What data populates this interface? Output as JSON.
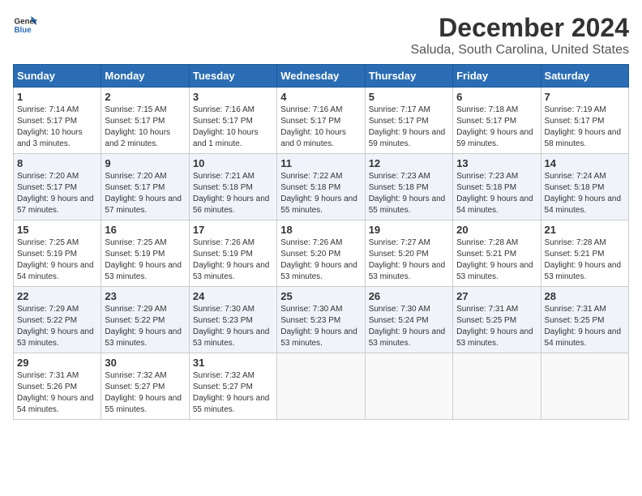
{
  "logo": {
    "line1": "General",
    "line2": "Blue"
  },
  "title": "December 2024",
  "location": "Saluda, South Carolina, United States",
  "days_of_week": [
    "Sunday",
    "Monday",
    "Tuesday",
    "Wednesday",
    "Thursday",
    "Friday",
    "Saturday"
  ],
  "weeks": [
    [
      {
        "day": "1",
        "sunrise": "7:14 AM",
        "sunset": "5:17 PM",
        "daylight": "10 hours and 3 minutes."
      },
      {
        "day": "2",
        "sunrise": "7:15 AM",
        "sunset": "5:17 PM",
        "daylight": "10 hours and 2 minutes."
      },
      {
        "day": "3",
        "sunrise": "7:16 AM",
        "sunset": "5:17 PM",
        "daylight": "10 hours and 1 minute."
      },
      {
        "day": "4",
        "sunrise": "7:16 AM",
        "sunset": "5:17 PM",
        "daylight": "10 hours and 0 minutes."
      },
      {
        "day": "5",
        "sunrise": "7:17 AM",
        "sunset": "5:17 PM",
        "daylight": "9 hours and 59 minutes."
      },
      {
        "day": "6",
        "sunrise": "7:18 AM",
        "sunset": "5:17 PM",
        "daylight": "9 hours and 59 minutes."
      },
      {
        "day": "7",
        "sunrise": "7:19 AM",
        "sunset": "5:17 PM",
        "daylight": "9 hours and 58 minutes."
      }
    ],
    [
      {
        "day": "8",
        "sunrise": "7:20 AM",
        "sunset": "5:17 PM",
        "daylight": "9 hours and 57 minutes."
      },
      {
        "day": "9",
        "sunrise": "7:20 AM",
        "sunset": "5:17 PM",
        "daylight": "9 hours and 57 minutes."
      },
      {
        "day": "10",
        "sunrise": "7:21 AM",
        "sunset": "5:18 PM",
        "daylight": "9 hours and 56 minutes."
      },
      {
        "day": "11",
        "sunrise": "7:22 AM",
        "sunset": "5:18 PM",
        "daylight": "9 hours and 55 minutes."
      },
      {
        "day": "12",
        "sunrise": "7:23 AM",
        "sunset": "5:18 PM",
        "daylight": "9 hours and 55 minutes."
      },
      {
        "day": "13",
        "sunrise": "7:23 AM",
        "sunset": "5:18 PM",
        "daylight": "9 hours and 54 minutes."
      },
      {
        "day": "14",
        "sunrise": "7:24 AM",
        "sunset": "5:18 PM",
        "daylight": "9 hours and 54 minutes."
      }
    ],
    [
      {
        "day": "15",
        "sunrise": "7:25 AM",
        "sunset": "5:19 PM",
        "daylight": "9 hours and 54 minutes."
      },
      {
        "day": "16",
        "sunrise": "7:25 AM",
        "sunset": "5:19 PM",
        "daylight": "9 hours and 53 minutes."
      },
      {
        "day": "17",
        "sunrise": "7:26 AM",
        "sunset": "5:19 PM",
        "daylight": "9 hours and 53 minutes."
      },
      {
        "day": "18",
        "sunrise": "7:26 AM",
        "sunset": "5:20 PM",
        "daylight": "9 hours and 53 minutes."
      },
      {
        "day": "19",
        "sunrise": "7:27 AM",
        "sunset": "5:20 PM",
        "daylight": "9 hours and 53 minutes."
      },
      {
        "day": "20",
        "sunrise": "7:28 AM",
        "sunset": "5:21 PM",
        "daylight": "9 hours and 53 minutes."
      },
      {
        "day": "21",
        "sunrise": "7:28 AM",
        "sunset": "5:21 PM",
        "daylight": "9 hours and 53 minutes."
      }
    ],
    [
      {
        "day": "22",
        "sunrise": "7:29 AM",
        "sunset": "5:22 PM",
        "daylight": "9 hours and 53 minutes."
      },
      {
        "day": "23",
        "sunrise": "7:29 AM",
        "sunset": "5:22 PM",
        "daylight": "9 hours and 53 minutes."
      },
      {
        "day": "24",
        "sunrise": "7:30 AM",
        "sunset": "5:23 PM",
        "daylight": "9 hours and 53 minutes."
      },
      {
        "day": "25",
        "sunrise": "7:30 AM",
        "sunset": "5:23 PM",
        "daylight": "9 hours and 53 minutes."
      },
      {
        "day": "26",
        "sunrise": "7:30 AM",
        "sunset": "5:24 PM",
        "daylight": "9 hours and 53 minutes."
      },
      {
        "day": "27",
        "sunrise": "7:31 AM",
        "sunset": "5:25 PM",
        "daylight": "9 hours and 53 minutes."
      },
      {
        "day": "28",
        "sunrise": "7:31 AM",
        "sunset": "5:25 PM",
        "daylight": "9 hours and 54 minutes."
      }
    ],
    [
      {
        "day": "29",
        "sunrise": "7:31 AM",
        "sunset": "5:26 PM",
        "daylight": "9 hours and 54 minutes."
      },
      {
        "day": "30",
        "sunrise": "7:32 AM",
        "sunset": "5:27 PM",
        "daylight": "9 hours and 55 minutes."
      },
      {
        "day": "31",
        "sunrise": "7:32 AM",
        "sunset": "5:27 PM",
        "daylight": "9 hours and 55 minutes."
      },
      null,
      null,
      null,
      null
    ]
  ],
  "labels": {
    "sunrise": "Sunrise:",
    "sunset": "Sunset:",
    "daylight": "Daylight:"
  }
}
